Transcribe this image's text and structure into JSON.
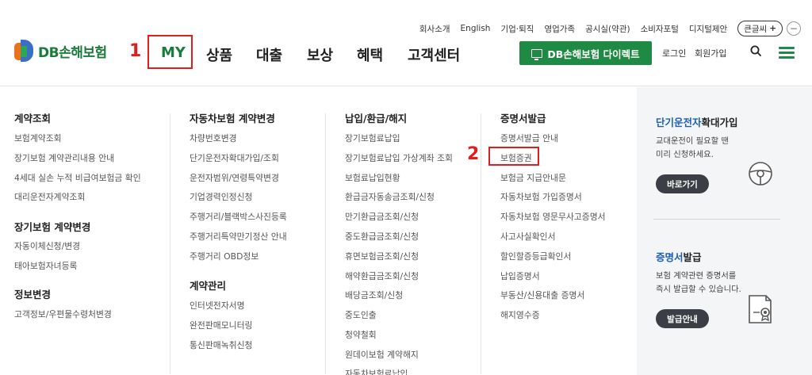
{
  "utility": [
    "회사소개",
    "English",
    "기업·퇴직",
    "영업가족",
    "공시실(약관)",
    "소비자포털",
    "디지털제안"
  ],
  "bigtext": {
    "label": "큰글씨",
    "plus": "+",
    "minus": "−"
  },
  "logo": {
    "text": "DB손해보험"
  },
  "annotations": {
    "one": "1",
    "two": "2"
  },
  "gnb": [
    "MY",
    "상품",
    "대출",
    "보상",
    "혜택",
    "고객센터"
  ],
  "direct_button": "DB손해보험 다이렉트",
  "login": "로그인",
  "join": "회원가입",
  "colors": {
    "brand_green": "#1e8a43",
    "highlight_blue": "#1d5fb8",
    "annotation_red": "#e31c1c"
  },
  "menu": {
    "col1": {
      "groups": [
        {
          "heading": "계약조회",
          "links": [
            "보험계약조회",
            "장기보험 계약관리내용 안내",
            "4세대 실손 누적 비급여보험금 확인",
            "대리운전자계약조회"
          ]
        },
        {
          "heading": "장기보험 계약변경",
          "links": [
            "자동이체신청/변경",
            "태아보험자녀등록"
          ]
        },
        {
          "heading": "정보변경",
          "links": [
            "고객정보/우편물수령처변경"
          ]
        }
      ]
    },
    "col2": {
      "groups": [
        {
          "heading": "자동차보험 계약변경",
          "links": [
            "차량번호변경",
            "단기운전자확대가입/조회",
            "운전자범위/연령특약변경",
            "기업경력인정신청",
            "주행거리/블랙박스사진등록",
            "주행거리특약만기정산 안내",
            "주행거리 OBD정보"
          ]
        },
        {
          "heading": "계약관리",
          "links": [
            "인터넷전자서명",
            "완전판매모니터링",
            "통신판매녹취신청"
          ]
        }
      ]
    },
    "col3": {
      "groups": [
        {
          "heading": "납입/환급/해지",
          "links": [
            "장기보험료납입",
            "장기보험료납입 가상계좌 조회",
            "보험료납입현황",
            "환급금자동송금조회/신청",
            "만기환급금조회/신청",
            "중도환급금조회/신청",
            "휴면보험금조회/신청",
            "해약환급금조회/신청",
            "배당금조회/신청",
            "중도인출",
            "청약철회",
            "원데이보험 계약해지",
            "자동차보험료납입"
          ]
        }
      ]
    },
    "col4": {
      "groups": [
        {
          "heading": "증명서발급",
          "links": [
            "증명서발급 안내",
            "보험증권",
            "보험금 지급안내문",
            "자동차보험 가입증명서",
            "자동차보험 영문무사고증명서",
            "사고사실확인서",
            "할인할증등급확인서",
            "납입증명서",
            "부동산/신용대출 증명서",
            "해지영수증"
          ]
        }
      ]
    }
  },
  "side": {
    "card1": {
      "title_hl": "단기운전자",
      "title_rest": "확대가입",
      "desc": [
        "교대운전이 필요할 땐",
        "미리 신청하세요."
      ],
      "button": "바로가기",
      "icon": "steering-wheel-icon"
    },
    "card2": {
      "title_hl": "증명서",
      "title_rest": "발급",
      "desc": [
        "보험 계약관련 증명서를",
        "즉시 발급할 수 있습니다."
      ],
      "button": "발급안내",
      "icon": "certificate-icon"
    }
  }
}
